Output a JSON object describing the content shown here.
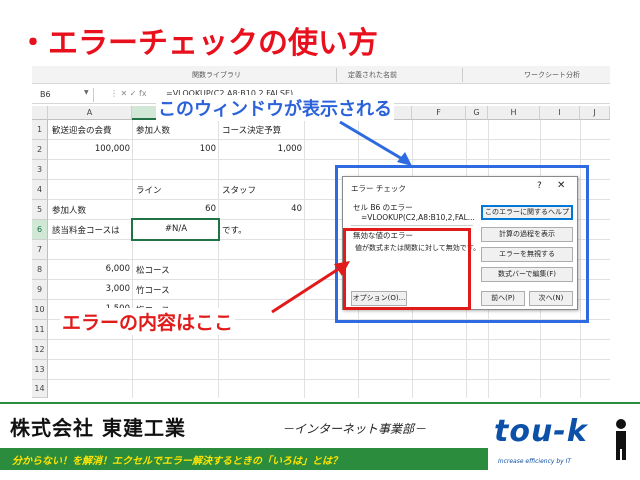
{
  "title": "・エラーチェックの使い方",
  "ribbon": {
    "groups": [
      "関数ライブラリ",
      "定義された名前",
      "ワークシート分析"
    ]
  },
  "formula_bar": {
    "name_box": "B6",
    "icons": "⋮   ✕   ✓   fx",
    "formula": "=VLOOKUP(C2,A8:B10,2,FALSE)"
  },
  "columns": [
    "A",
    "B",
    "C",
    "D",
    "E",
    "F",
    "G",
    "H",
    "I",
    "J"
  ],
  "rows": [
    "1",
    "2",
    "3",
    "4",
    "5",
    "6",
    "7",
    "8",
    "9",
    "10",
    "11",
    "12",
    "13",
    "14"
  ],
  "cells": {
    "a1": "歓送迎会の会費",
    "b1": "参加人数",
    "c1": "コース決定予算",
    "a2": "100,000",
    "b2": "100",
    "c2": "1,000",
    "b4": "ライン",
    "c4": "スタッフ",
    "a5": "参加人数",
    "b5": "60",
    "c5": "40",
    "a6": "該当料金コースは",
    "b6": "#N/A",
    "c6": "です。",
    "a8": "6,000",
    "b8": "松コース",
    "a9": "3,000",
    "b9": "竹コース",
    "a10": "1,500",
    "b10": "梅コース"
  },
  "dialog": {
    "title": "エラー チェック",
    "help": "?",
    "close": "✕",
    "cell_label": "セル B6 のエラー",
    "formula": "=VLOOKUP(C2,A8:B10,2,FAL...",
    "error_type": "無効な値のエラー",
    "error_desc": "値が数式または関数に対して無効です。",
    "buttons": {
      "help": "このエラーに関するヘルプ",
      "steps": "計算の過程を表示",
      "ignore": "エラーを無視する",
      "edit": "数式バーで編集(F)",
      "options": "オプション(O)...",
      "prev": "前へ(P)",
      "next": "次へ(N)"
    }
  },
  "callouts": {
    "window": "このウィンドウが表示される",
    "content": "エラーの内容はここ"
  },
  "footer": {
    "company": "株式会社 東建工業",
    "dept": "－インターネット事業部－",
    "subtitle": "分からない！を解消！エクセルでエラー解決するときの「いろは」とは？",
    "logo": "tou-k",
    "logo_tag": "Increase efficiency by IT"
  },
  "colors": {
    "title_red": "#e8101c",
    "callout_blue": "#2e6ae0",
    "callout_red": "#e11a1a",
    "footer_green": "#2a8c3c",
    "subtitle_yellow": "#ffe400",
    "logo_blue": "#0c50a8"
  }
}
